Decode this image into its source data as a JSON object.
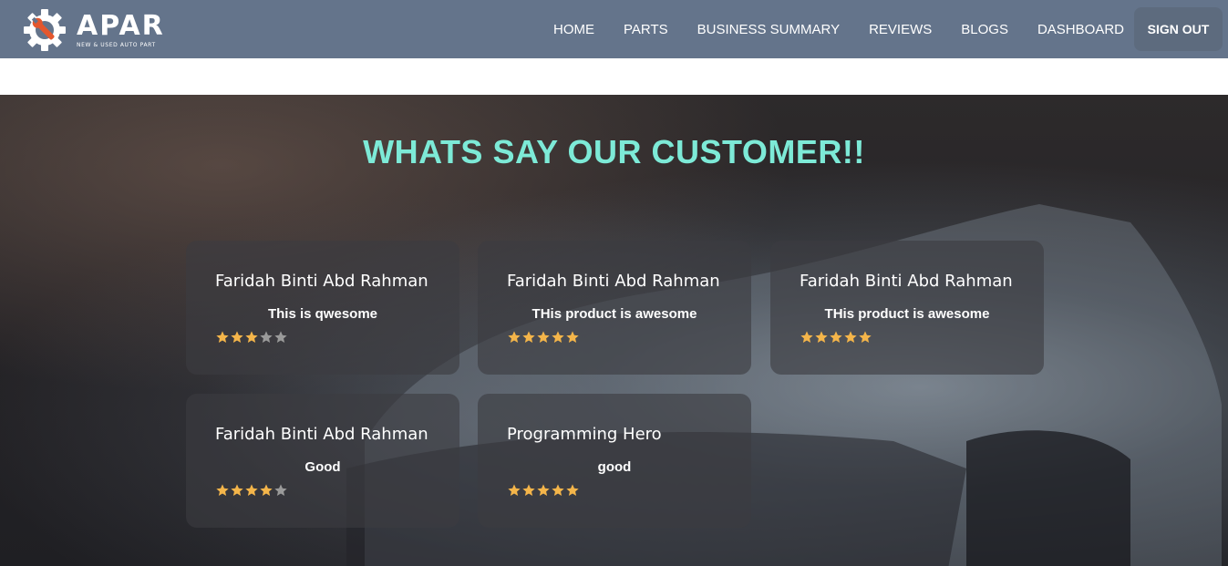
{
  "brand": {
    "name": "APAR",
    "tagline": "NEW & USED AUTO PART",
    "accent": "#e4572e"
  },
  "nav": {
    "links": [
      "HOME",
      "PARTS",
      "BUSINESS SUMMARY",
      "REVIEWS",
      "BLOGS",
      "DASHBOARD"
    ],
    "signout_label": "SIGN OUT"
  },
  "reviews": {
    "title": "WHATS SAY OUR CUSTOMER!!",
    "title_color": "#7dead7",
    "star_color": "#f4b54a",
    "items": [
      {
        "name": "Faridah Binti Abd Rahman",
        "comment": "This is qwesome",
        "rating": 3,
        "max": 5
      },
      {
        "name": "Faridah Binti Abd Rahman",
        "comment": "THis product is awesome",
        "rating": 5,
        "max": 5
      },
      {
        "name": "Faridah Binti Abd Rahman",
        "comment": "THis product is awesome",
        "rating": 5,
        "max": 5
      },
      {
        "name": "Faridah Binti Abd Rahman",
        "comment": "Good",
        "rating": 4,
        "max": 5
      },
      {
        "name": "Programming Hero",
        "comment": "good",
        "rating": 5,
        "max": 5
      }
    ]
  }
}
